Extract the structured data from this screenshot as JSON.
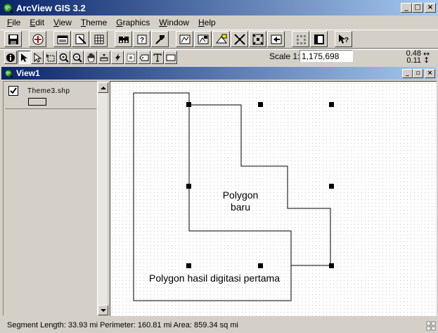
{
  "window": {
    "title": "ArcView GIS 3.2",
    "minimize": "_",
    "maximize": "□",
    "close": "×"
  },
  "menu": [
    {
      "label": "File",
      "key": "F",
      "rest": "ile"
    },
    {
      "label": "Edit",
      "key": "E",
      "rest": "dit"
    },
    {
      "label": "View",
      "key": "V",
      "rest": "iew"
    },
    {
      "label": "Theme",
      "key": "T",
      "rest": "heme"
    },
    {
      "label": "Graphics",
      "key": "G",
      "rest": "raphics"
    },
    {
      "label": "Window",
      "key": "W",
      "rest": "indow"
    },
    {
      "label": "Help",
      "key": "H",
      "rest": "elp"
    }
  ],
  "toolbar": {
    "buttons": [
      "save-icon",
      "add-theme-icon",
      "theme-properties-icon",
      "edit-legend-icon",
      "open-table-icon",
      "find-icon",
      "query-builder-icon",
      "locate-address-icon",
      "zoom-to-full-extent-icon",
      "zoom-to-active-themes-icon",
      "zoom-to-selected-icon",
      "zoom-in-fixed-icon",
      "zoom-out-fixed-icon",
      "zoom-previous-icon",
      "select-by-theme-icon",
      "clear-selected-icon",
      "help-icon"
    ]
  },
  "tools": [
    "identify-icon",
    "pointer-icon",
    "vertex-edit-icon",
    "select-feature-icon",
    "zoom-in-icon",
    "zoom-out-icon",
    "pan-icon",
    "measure-icon",
    "hot-link-icon",
    "area-of-interest-icon",
    "label-icon",
    "text-icon",
    "draw-icon"
  ],
  "scale": {
    "label": "Scale 1:",
    "value": "1,175,698"
  },
  "coords": {
    "x": "0.48",
    "y": "0.11",
    "icon": "↔\n↕"
  },
  "view": {
    "title": "View1",
    "minimize": "_",
    "restore": "▫",
    "close": "×"
  },
  "toc": {
    "theme_name": "Theme3.shp",
    "checked": true
  },
  "map": {
    "label_new": "Polygon\nbaru",
    "label_first": "Polygon hasil digitasi pertama"
  },
  "status": {
    "text": "Segment Length: 33.93 mi  Perimeter: 160.81 mi  Area: 859.34 sq mi"
  },
  "colors": {
    "title_start": "#0a246a",
    "title_end": "#a6caf0",
    "face": "#d4d0c8"
  }
}
